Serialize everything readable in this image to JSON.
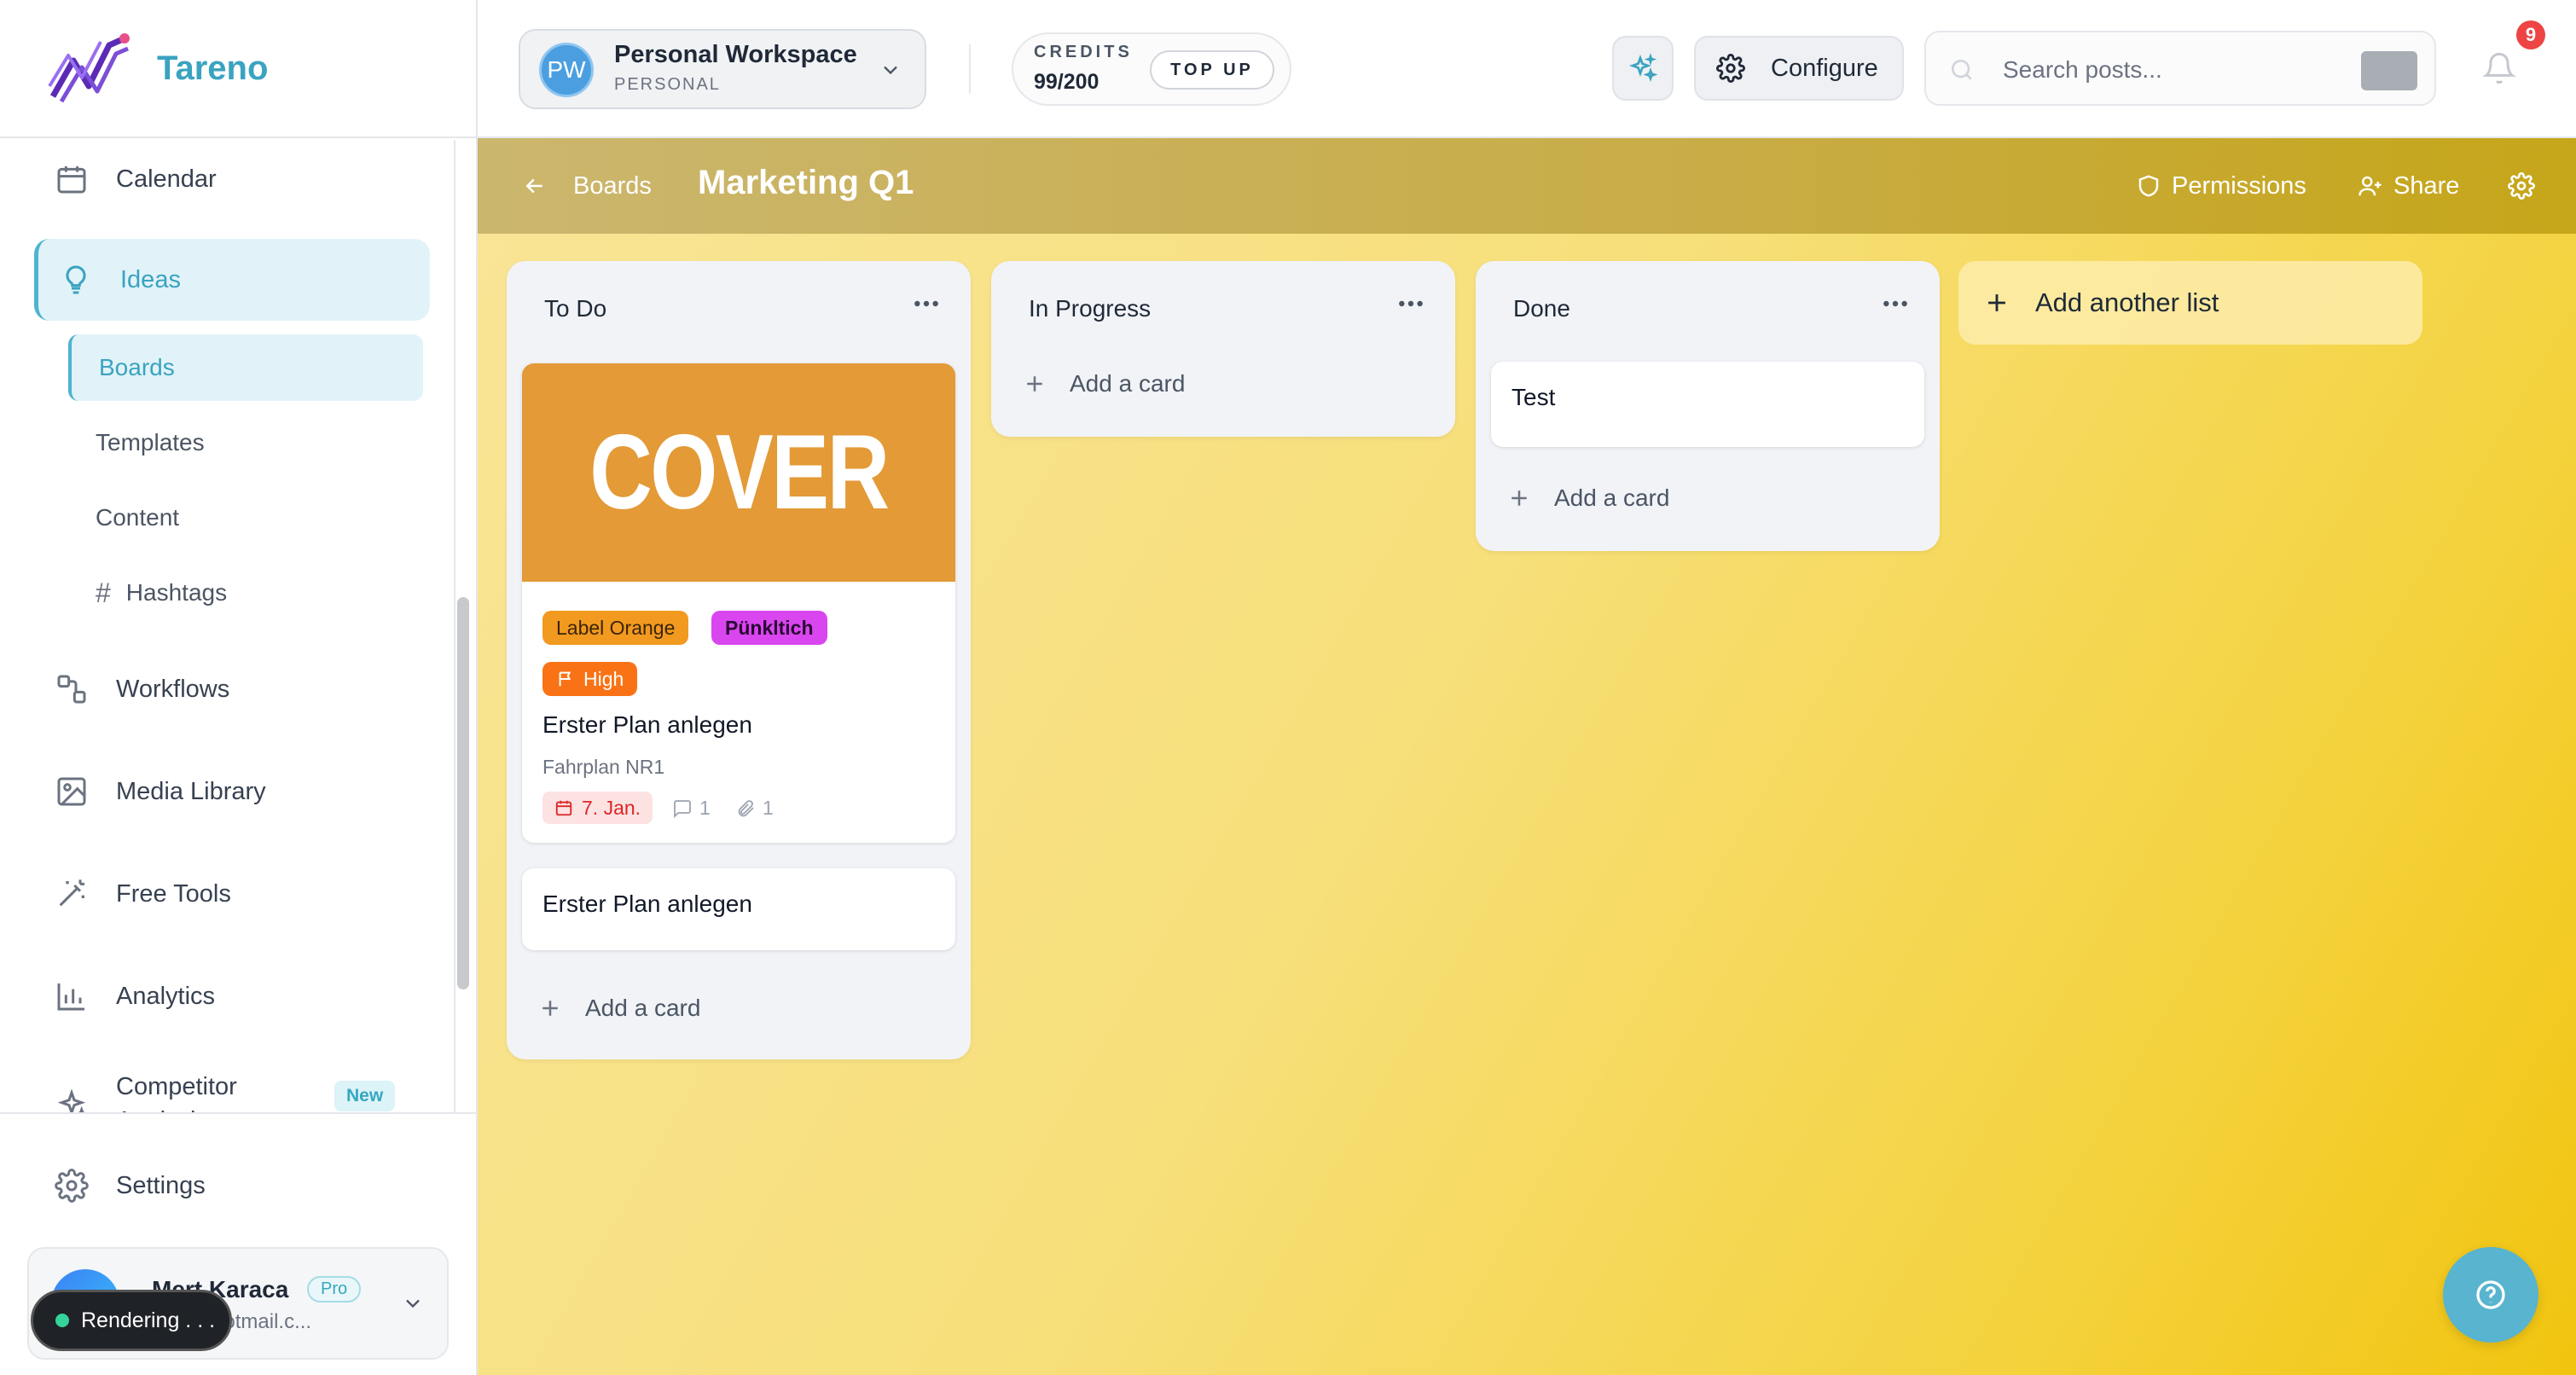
{
  "app": {
    "name": "Tareno"
  },
  "sidebar": {
    "items": [
      {
        "label": "Calendar",
        "icon": "calendar-icon"
      },
      {
        "label": "Ideas",
        "icon": "lightbulb-icon",
        "active": true
      },
      {
        "label": "Workflows",
        "icon": "workflow-icon"
      },
      {
        "label": "Media Library",
        "icon": "image-icon"
      },
      {
        "label": "Free Tools",
        "icon": "magic-wand-icon"
      },
      {
        "label": "Analytics",
        "icon": "bar-chart-icon"
      },
      {
        "label": "Competitor Analysis",
        "icon": "sparkles-icon",
        "badge": "New"
      }
    ],
    "subitems": [
      {
        "label": "Boards",
        "active": true
      },
      {
        "label": "Templates"
      },
      {
        "label": "Content"
      },
      {
        "label": "Hashtags",
        "prefix": "#"
      }
    ],
    "settings_label": "Settings",
    "user": {
      "name": "Mert Karaca",
      "plan": "Pro",
      "email": "...97@hotmail.c..."
    },
    "render_status": "Rendering . . ."
  },
  "header": {
    "workspace": {
      "initials": "PW",
      "name": "Personal Workspace",
      "type": "PERSONAL"
    },
    "credits": {
      "label": "CREDITS",
      "value": "99/200",
      "topup_label": "TOP UP"
    },
    "configure_label": "Configure",
    "search": {
      "placeholder": "Search posts..."
    },
    "notifications": {
      "count": "9"
    }
  },
  "board": {
    "back_label": "Boards",
    "title": "Marketing Q1",
    "actions": {
      "permissions": "Permissions",
      "share": "Share"
    },
    "add_card_label": "Add a card",
    "add_list_label": "Add another list",
    "lists": [
      {
        "title": "To Do",
        "cards": [
          {
            "cover_text": "COVER",
            "labels": [
              "Label Orange",
              "Pünkltich"
            ],
            "priority": "High",
            "title": "Erster Plan anlegen",
            "subtitle": "Fahrplan NR1",
            "due": "7. Jan.",
            "comments": "1",
            "attachments": "1"
          },
          {
            "title": "Erster Plan anlegen"
          }
        ]
      },
      {
        "title": "In Progress",
        "cards": []
      },
      {
        "title": "Done",
        "cards": [
          {
            "title": "Test"
          }
        ]
      }
    ]
  },
  "colors": {
    "brand": "#3aa3c0",
    "cover": "#e39a37",
    "label_orange": "#f29a1f",
    "label_magenta": "#d946ef",
    "priority_high": "#f97316",
    "notification": "#ef4444"
  }
}
